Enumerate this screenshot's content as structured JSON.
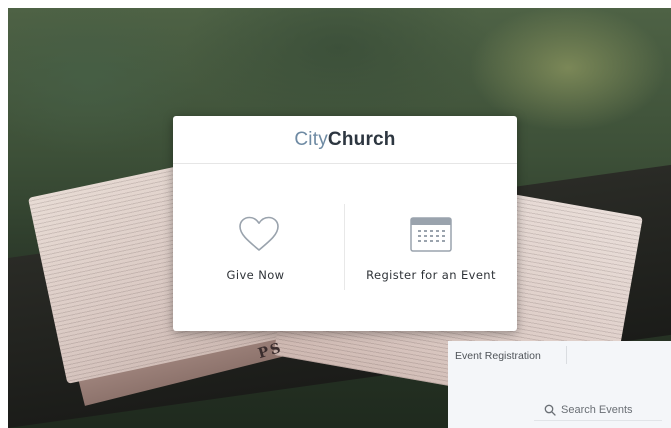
{
  "brand": {
    "name_light": "City",
    "name_bold": "Church",
    "accent_color": "#6e8aa3",
    "text_color": "#2d3640"
  },
  "actions": [
    {
      "label": "Give Now",
      "icon": "heart-icon"
    },
    {
      "label": "Register for an Event",
      "icon": "calendar-icon"
    }
  ],
  "background": {
    "psalm_text": "PS",
    "description_colors": [
      "#4e6245",
      "#e8dcd5"
    ]
  },
  "event_panel": {
    "title": "Event Registration",
    "search_label": "Search Events",
    "search_icon": "search-icon",
    "background_color": "#f4f6f9"
  }
}
